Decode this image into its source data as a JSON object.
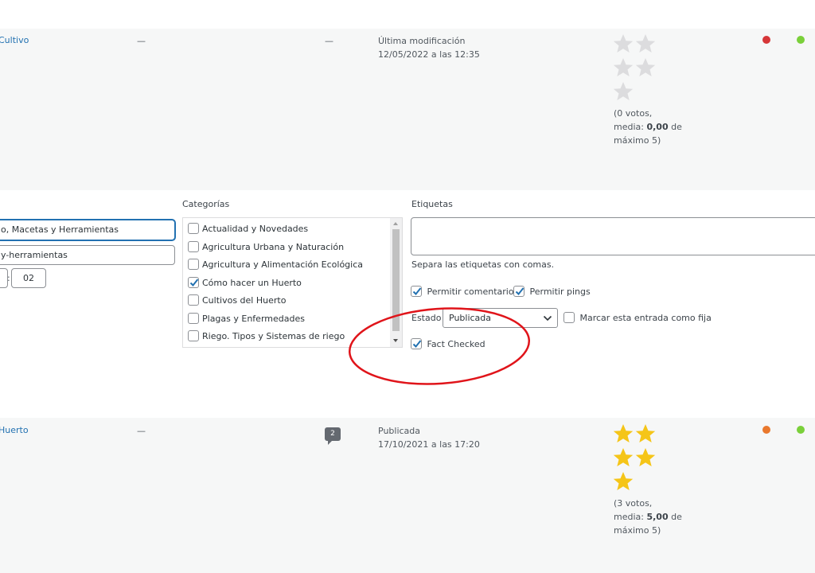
{
  "row1": {
    "title": "Cultivo",
    "author": "—",
    "comments": "—",
    "date_status": "Última modificación",
    "date": "12/05/2022 a las 12:35",
    "rating_text_1": "(0 votos,",
    "rating_text_2_pre": "media: ",
    "rating_text_2_val": "0,00",
    "rating_text_2_post": " de",
    "rating_text_3": "máximo 5)",
    "stars_filled": 0,
    "dot1_color": "#d63638",
    "dot2_color": "#7ad03a"
  },
  "quick_edit": {
    "category_field_value": "o, Macetas y Herramientas",
    "slug_field_value": "y-herramientas",
    "time_minutes": "02",
    "time_separator": ":",
    "categories_label": "Categorías",
    "categories": [
      {
        "label": "Actualidad y Novedades",
        "checked": false
      },
      {
        "label": "Agricultura Urbana y Naturación",
        "checked": false
      },
      {
        "label": "Agricultura y Alimentación Ecológica",
        "checked": false
      },
      {
        "label": "Cómo hacer un Huerto",
        "checked": true
      },
      {
        "label": "Cultivos del Huerto",
        "checked": false
      },
      {
        "label": "Plagas y Enfermedades",
        "checked": false
      },
      {
        "label": "Riego. Tipos y Sistemas de riego",
        "checked": false
      }
    ],
    "tags_label": "Etiquetas",
    "tags_value": "",
    "tags_help": "Separa las etiquetas con comas.",
    "allow_comments_label": "Permitir comentarios",
    "allow_pings_label": "Permitir pings",
    "status_label": "Estado",
    "status_value": "Publicada",
    "sticky_label": "Marcar esta entrada como fija",
    "fact_checked_label": "Fact Checked",
    "annotation_color": "#e0141a"
  },
  "row2": {
    "title": "Huerto",
    "author": "—",
    "comment_count": "2",
    "date_status": "Publicada",
    "date": "17/10/2021 a las 17:20",
    "rating_text_1": "(3 votos,",
    "rating_text_2_pre": "media: ",
    "rating_text_2_val": "5,00",
    "rating_text_2_post": " de",
    "rating_text_3": "máximo 5)",
    "stars_filled": 5,
    "dot1_color": "#e9782d",
    "dot2_color": "#7ad03a"
  },
  "colors": {
    "star_filled": "#f5c518",
    "star_empty": "#dcdcde",
    "link": "#2271b1",
    "focus": "#2271b1"
  }
}
